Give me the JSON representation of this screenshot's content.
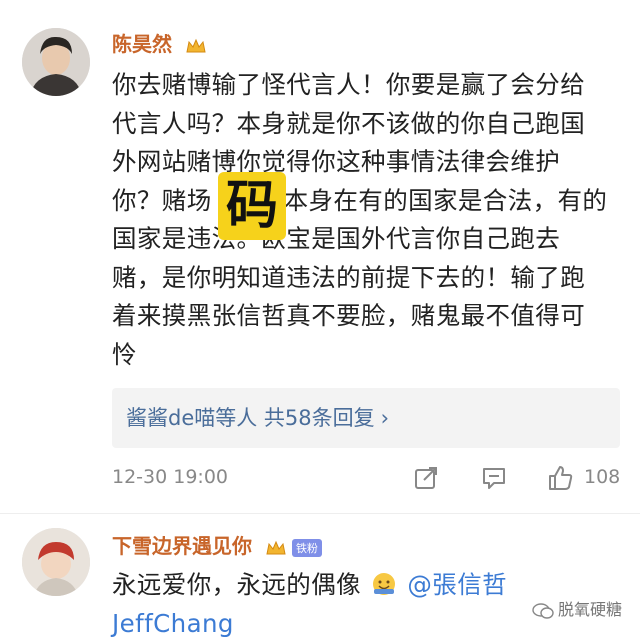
{
  "comment1": {
    "username": "陈昊然",
    "text_lines": [
      "你去赌博输了怪代言人！你要是赢了会分给",
      "代言人吗？本身就是你不该做的你自己跑国",
      "外网站赌博你觉得你这种事情法律会维护",
      "你？赌场",
      "本身在有的国家是合法，有的",
      "国家是违法。欧宝是国外代言你自己跑去",
      "赌，是你明知道违法的前提下去的！输了跑",
      "着来摸黑张信哲真不要脸，赌鬼最不值得可",
      "怜"
    ],
    "replies_summary": "酱酱de喵等人 共58条回复",
    "reply_chevron": "›",
    "timestamp": "12-30 19:00",
    "like_count": "108",
    "overlay_char": "码"
  },
  "comment2": {
    "username": "下雪边界遇见你",
    "fan_badge": "铁粉",
    "text_prefix": "永远爱你，永远的偶像",
    "mention_line1": "@張信哲",
    "mention_line2": "JeffChang"
  },
  "watermark": {
    "text": "脱氧硬糖"
  },
  "colors": {
    "username": "#c8652a",
    "mention": "#3c7bd4",
    "reply_link": "#4a6d9a",
    "overlay_bg": "#f6d21b"
  }
}
